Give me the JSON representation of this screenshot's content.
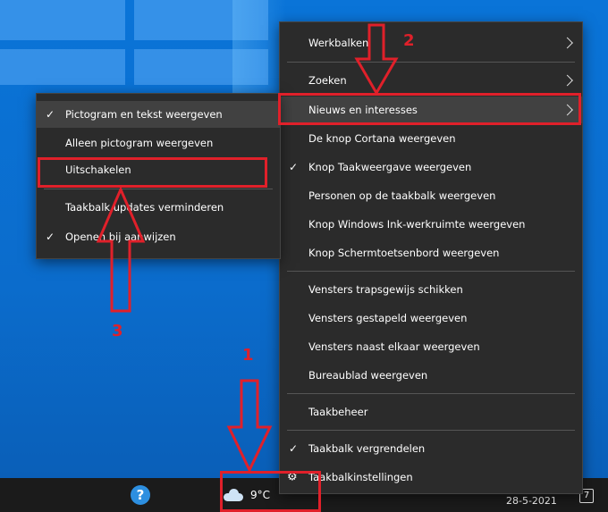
{
  "context_menu": {
    "items": [
      {
        "label": "Werkbalken",
        "submenu": true
      },
      {
        "label": "Zoeken",
        "submenu": true
      },
      {
        "label": "Nieuws en interesses",
        "submenu": true,
        "highlighted": true
      },
      {
        "label": "De knop Cortana weergeven"
      },
      {
        "label": "Knop Taakweergave weergeven",
        "checked": true
      },
      {
        "label": "Personen op de taakbalk weergeven"
      },
      {
        "label": "Knop Windows Ink-werkruimte weergeven"
      },
      {
        "label": "Knop Schermtoetsenbord weergeven"
      },
      {
        "label": "Vensters trapsgewijs schikken"
      },
      {
        "label": "Vensters gestapeld weergeven"
      },
      {
        "label": "Vensters naast elkaar weergeven"
      },
      {
        "label": "Bureaublad weergeven"
      },
      {
        "label": "Taakbeheer"
      },
      {
        "label": "Taakbalk vergrendelen",
        "checked": true
      },
      {
        "label": "Taakbalkinstellingen",
        "icon": "gear-icon"
      }
    ]
  },
  "submenu": {
    "items": [
      {
        "label": "Pictogram en tekst weergeven",
        "checked": true,
        "highlighted": true
      },
      {
        "label": "Alleen pictogram weergeven"
      },
      {
        "label": "Uitschakelen"
      },
      {
        "label": "Taakbalk updates verminderen"
      },
      {
        "label": "Openen bij aanwijzen",
        "checked": true
      }
    ]
  },
  "taskbar": {
    "weather": "9°C",
    "date": "28-5-2021",
    "notification_count": "7",
    "help_icon": "help-icon"
  },
  "annotations": {
    "step1": "1",
    "step2": "2",
    "step3": "3",
    "color": "#e0202a"
  }
}
